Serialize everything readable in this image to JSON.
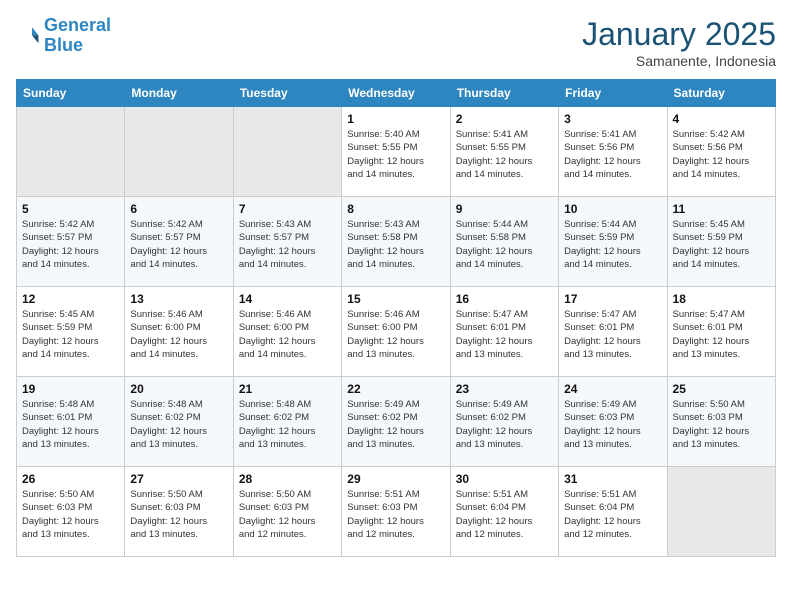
{
  "logo": {
    "line1": "General",
    "line2": "Blue"
  },
  "title": "January 2025",
  "subtitle": "Samanente, Indonesia",
  "days_of_week": [
    "Sunday",
    "Monday",
    "Tuesday",
    "Wednesday",
    "Thursday",
    "Friday",
    "Saturday"
  ],
  "weeks": [
    [
      {
        "day": "",
        "info": ""
      },
      {
        "day": "",
        "info": ""
      },
      {
        "day": "",
        "info": ""
      },
      {
        "day": "1",
        "info": "Sunrise: 5:40 AM\nSunset: 5:55 PM\nDaylight: 12 hours\nand 14 minutes."
      },
      {
        "day": "2",
        "info": "Sunrise: 5:41 AM\nSunset: 5:55 PM\nDaylight: 12 hours\nand 14 minutes."
      },
      {
        "day": "3",
        "info": "Sunrise: 5:41 AM\nSunset: 5:56 PM\nDaylight: 12 hours\nand 14 minutes."
      },
      {
        "day": "4",
        "info": "Sunrise: 5:42 AM\nSunset: 5:56 PM\nDaylight: 12 hours\nand 14 minutes."
      }
    ],
    [
      {
        "day": "5",
        "info": "Sunrise: 5:42 AM\nSunset: 5:57 PM\nDaylight: 12 hours\nand 14 minutes."
      },
      {
        "day": "6",
        "info": "Sunrise: 5:42 AM\nSunset: 5:57 PM\nDaylight: 12 hours\nand 14 minutes."
      },
      {
        "day": "7",
        "info": "Sunrise: 5:43 AM\nSunset: 5:57 PM\nDaylight: 12 hours\nand 14 minutes."
      },
      {
        "day": "8",
        "info": "Sunrise: 5:43 AM\nSunset: 5:58 PM\nDaylight: 12 hours\nand 14 minutes."
      },
      {
        "day": "9",
        "info": "Sunrise: 5:44 AM\nSunset: 5:58 PM\nDaylight: 12 hours\nand 14 minutes."
      },
      {
        "day": "10",
        "info": "Sunrise: 5:44 AM\nSunset: 5:59 PM\nDaylight: 12 hours\nand 14 minutes."
      },
      {
        "day": "11",
        "info": "Sunrise: 5:45 AM\nSunset: 5:59 PM\nDaylight: 12 hours\nand 14 minutes."
      }
    ],
    [
      {
        "day": "12",
        "info": "Sunrise: 5:45 AM\nSunset: 5:59 PM\nDaylight: 12 hours\nand 14 minutes."
      },
      {
        "day": "13",
        "info": "Sunrise: 5:46 AM\nSunset: 6:00 PM\nDaylight: 12 hours\nand 14 minutes."
      },
      {
        "day": "14",
        "info": "Sunrise: 5:46 AM\nSunset: 6:00 PM\nDaylight: 12 hours\nand 14 minutes."
      },
      {
        "day": "15",
        "info": "Sunrise: 5:46 AM\nSunset: 6:00 PM\nDaylight: 12 hours\nand 13 minutes."
      },
      {
        "day": "16",
        "info": "Sunrise: 5:47 AM\nSunset: 6:01 PM\nDaylight: 12 hours\nand 13 minutes."
      },
      {
        "day": "17",
        "info": "Sunrise: 5:47 AM\nSunset: 6:01 PM\nDaylight: 12 hours\nand 13 minutes."
      },
      {
        "day": "18",
        "info": "Sunrise: 5:47 AM\nSunset: 6:01 PM\nDaylight: 12 hours\nand 13 minutes."
      }
    ],
    [
      {
        "day": "19",
        "info": "Sunrise: 5:48 AM\nSunset: 6:01 PM\nDaylight: 12 hours\nand 13 minutes."
      },
      {
        "day": "20",
        "info": "Sunrise: 5:48 AM\nSunset: 6:02 PM\nDaylight: 12 hours\nand 13 minutes."
      },
      {
        "day": "21",
        "info": "Sunrise: 5:48 AM\nSunset: 6:02 PM\nDaylight: 12 hours\nand 13 minutes."
      },
      {
        "day": "22",
        "info": "Sunrise: 5:49 AM\nSunset: 6:02 PM\nDaylight: 12 hours\nand 13 minutes."
      },
      {
        "day": "23",
        "info": "Sunrise: 5:49 AM\nSunset: 6:02 PM\nDaylight: 12 hours\nand 13 minutes."
      },
      {
        "day": "24",
        "info": "Sunrise: 5:49 AM\nSunset: 6:03 PM\nDaylight: 12 hours\nand 13 minutes."
      },
      {
        "day": "25",
        "info": "Sunrise: 5:50 AM\nSunset: 6:03 PM\nDaylight: 12 hours\nand 13 minutes."
      }
    ],
    [
      {
        "day": "26",
        "info": "Sunrise: 5:50 AM\nSunset: 6:03 PM\nDaylight: 12 hours\nand 13 minutes."
      },
      {
        "day": "27",
        "info": "Sunrise: 5:50 AM\nSunset: 6:03 PM\nDaylight: 12 hours\nand 13 minutes."
      },
      {
        "day": "28",
        "info": "Sunrise: 5:50 AM\nSunset: 6:03 PM\nDaylight: 12 hours\nand 12 minutes."
      },
      {
        "day": "29",
        "info": "Sunrise: 5:51 AM\nSunset: 6:03 PM\nDaylight: 12 hours\nand 12 minutes."
      },
      {
        "day": "30",
        "info": "Sunrise: 5:51 AM\nSunset: 6:04 PM\nDaylight: 12 hours\nand 12 minutes."
      },
      {
        "day": "31",
        "info": "Sunrise: 5:51 AM\nSunset: 6:04 PM\nDaylight: 12 hours\nand 12 minutes."
      },
      {
        "day": "",
        "info": ""
      }
    ]
  ]
}
